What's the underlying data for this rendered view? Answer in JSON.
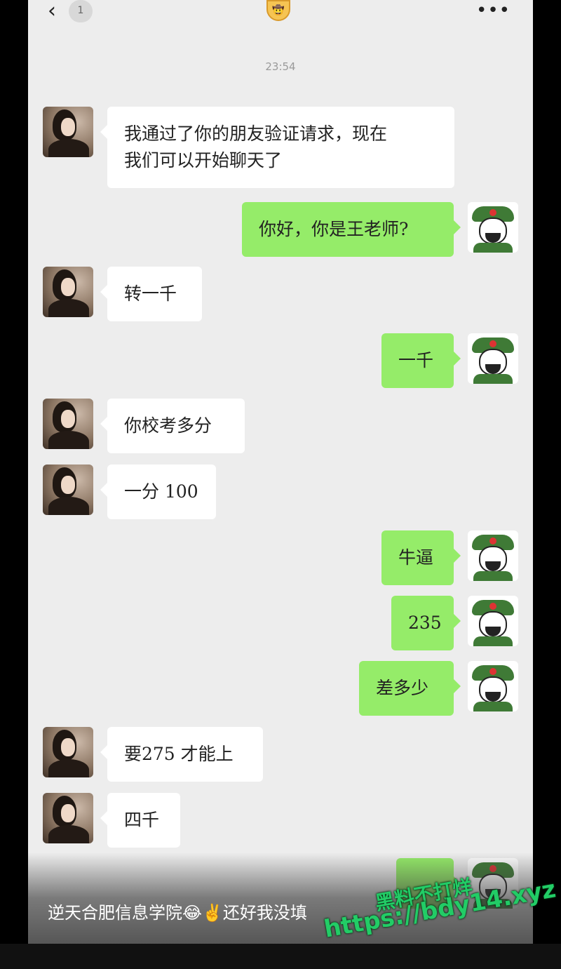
{
  "header": {
    "unread_count": "1",
    "title_emoji": "🤠",
    "more_label": "•••"
  },
  "timestamp": "23:54",
  "messages": [
    {
      "side": "left",
      "text": "我通过了你的朋友验证请求，现在\n我们可以开始聊天了"
    },
    {
      "side": "right",
      "text": "你好，你是王老师?"
    },
    {
      "side": "left",
      "text": "转一千"
    },
    {
      "side": "right",
      "text": "一千"
    },
    {
      "side": "left",
      "text": "你校考多分"
    },
    {
      "side": "left",
      "text": "一分 100"
    },
    {
      "side": "right",
      "text": "牛逼"
    },
    {
      "side": "right",
      "text": "235"
    },
    {
      "side": "right",
      "text": "差多少"
    },
    {
      "side": "left",
      "text": "要275 才能上"
    },
    {
      "side": "left",
      "text": "四千"
    },
    {
      "side": "right",
      "text": ""
    }
  ],
  "caption": "逆天合肥信息学院😂✌️还好我没填",
  "watermark": {
    "line1": "黑料不打烊",
    "line2": "https://bdy14.xyz"
  },
  "colors": {
    "background": "#ededed",
    "sent_bubble": "#95ec69",
    "received_bubble": "#ffffff",
    "watermark": "#22cc66"
  }
}
